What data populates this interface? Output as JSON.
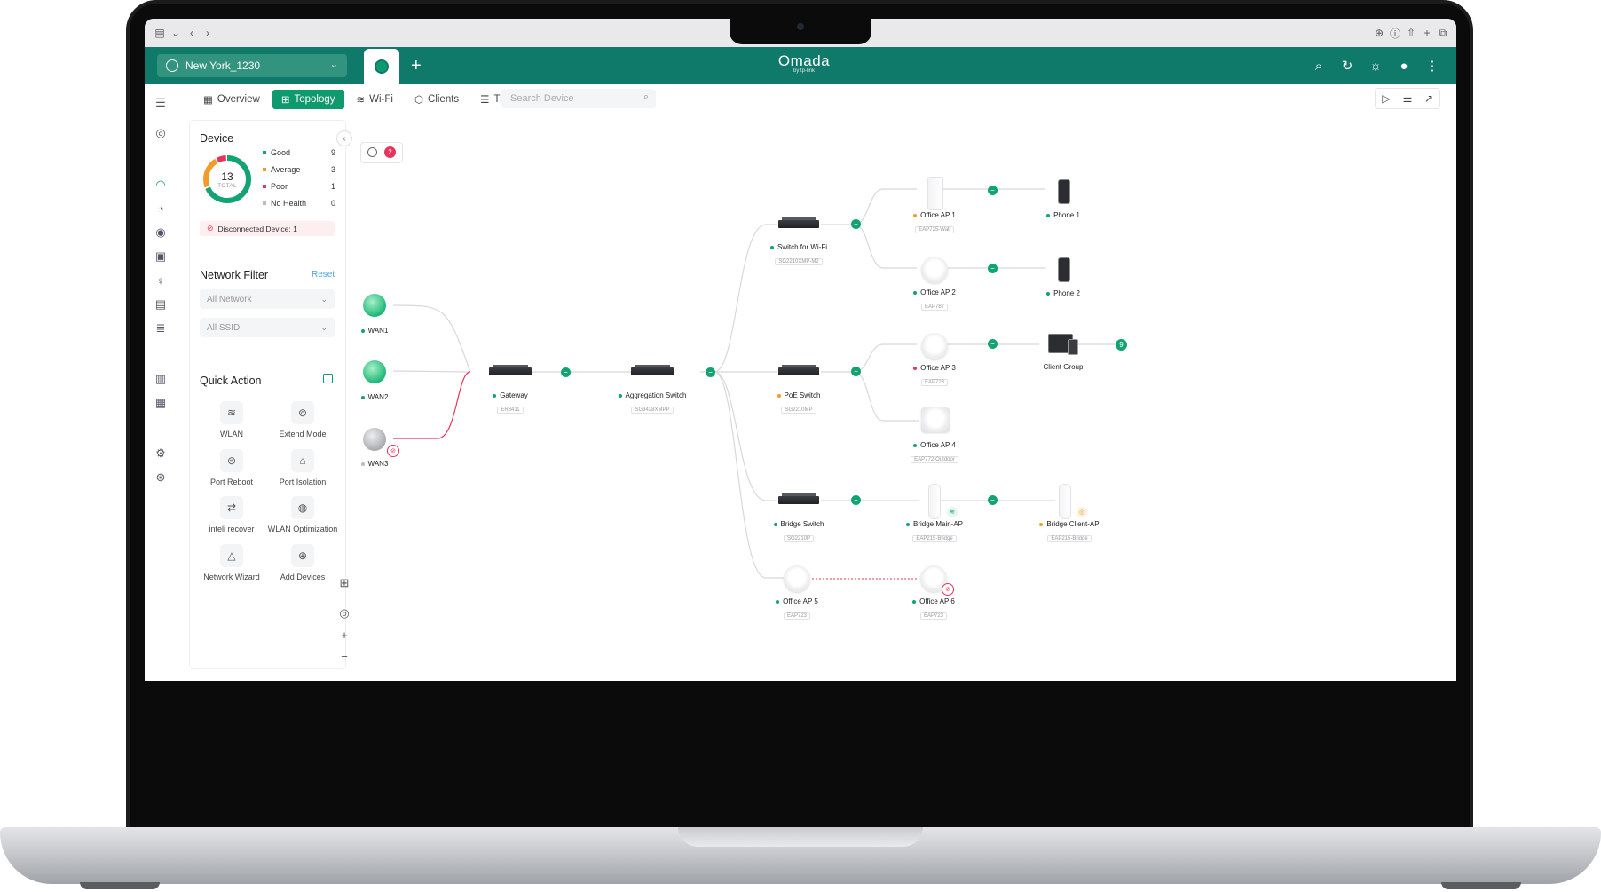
{
  "site": {
    "name": "New York_1230"
  },
  "logo": {
    "brand": "Omada",
    "sub": "by tp-link"
  },
  "tabs": [
    {
      "label": "Overview",
      "icon": "grid-icon"
    },
    {
      "label": "Topology",
      "icon": "topology-icon"
    },
    {
      "label": "Wi-Fi",
      "icon": "wifi-icon"
    },
    {
      "label": "Clients",
      "icon": "clients-icon"
    },
    {
      "label": "Traffic",
      "icon": "traffic-icon"
    }
  ],
  "search": {
    "placeholder": "Search Device"
  },
  "device_panel": {
    "title": "Device",
    "total": "13",
    "total_label": "TOTAL",
    "legend": [
      {
        "label": "Good",
        "count": "9",
        "color": "#12a370"
      },
      {
        "label": "Average",
        "count": "3",
        "color": "#f39a2b"
      },
      {
        "label": "Poor",
        "count": "1",
        "color": "#e8345a"
      },
      {
        "label": "No Health",
        "count": "0",
        "color": "#b9bcc1"
      }
    ],
    "disconnected": "Disconnected Device: 1"
  },
  "network_filter": {
    "title": "Network Filter",
    "reset": "Reset",
    "network": "All Network",
    "ssid": "All SSID"
  },
  "quick_action": {
    "title": "Quick Action",
    "items": [
      {
        "label": "WLAN",
        "icon": "wifi-icon"
      },
      {
        "label": "Extend Mode",
        "icon": "extend-icon"
      },
      {
        "label": "Port Reboot",
        "icon": "reboot-icon"
      },
      {
        "label": "Port Isolation",
        "icon": "isolation-icon"
      },
      {
        "label": "inteli recover",
        "icon": "recover-icon"
      },
      {
        "label": "WLAN Optimization",
        "icon": "optimize-icon"
      },
      {
        "label": "Network Wizard",
        "icon": "wizard-icon"
      },
      {
        "label": "Add Devices",
        "icon": "add-device-icon"
      }
    ]
  },
  "alerts": {
    "count": "2"
  },
  "topology": {
    "wans": [
      {
        "label": "WAN1",
        "status": "online"
      },
      {
        "label": "WAN2",
        "status": "online"
      },
      {
        "label": "WAN3",
        "status": "offline"
      }
    ],
    "gateway": {
      "label": "Gateway",
      "model": "ER8411"
    },
    "aggregation": {
      "label": "Aggregation Switch",
      "model": "SG3428XMPP"
    },
    "switches": [
      {
        "label": "Switch for Wi-Fi",
        "model": "SG2210XMP-M2"
      },
      {
        "label": "PoE Switch",
        "model": "SG2210MP"
      },
      {
        "label": "Bridge Switch",
        "model": "SG2210P"
      }
    ],
    "aps": [
      {
        "label": "Office AP 1",
        "model": "EAP725-Wall"
      },
      {
        "label": "Office AP 2",
        "model": "EAP787"
      },
      {
        "label": "Office AP 3",
        "model": "EAP723"
      },
      {
        "label": "Office AP 4",
        "model": "EAP772-Outdoor"
      },
      {
        "label": "Bridge Main-AP",
        "model": "EAP215-Bridge"
      },
      {
        "label": "Bridge Client-AP",
        "model": "EAP215-Bridge"
      },
      {
        "label": "Office AP 5",
        "model": "EAP723"
      },
      {
        "label": "Office AP 6",
        "model": "EAP723"
      }
    ],
    "clients": [
      {
        "label": "Phone 1"
      },
      {
        "label": "Phone 2"
      },
      {
        "label": "Client Group",
        "count": "9"
      }
    ]
  },
  "colors": {
    "brand": "#0f7a6a",
    "accent": "#0f9a6e",
    "good": "#12a370",
    "average": "#f39a2b",
    "poor": "#e8345a"
  }
}
